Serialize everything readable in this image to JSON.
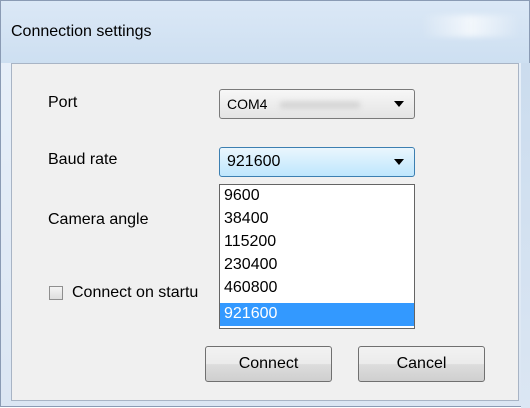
{
  "window": {
    "title": "Connection settings"
  },
  "port": {
    "label": "Port",
    "value": "COM4"
  },
  "baud": {
    "label": "Baud rate",
    "value": "921600",
    "options": [
      "9600",
      "38400",
      "115200",
      "230400",
      "460800",
      "921600"
    ],
    "selected_index": 5
  },
  "camera": {
    "label": "Camera angle"
  },
  "startup": {
    "label": "Connect on startu",
    "checked": false
  },
  "buttons": {
    "connect": "Connect",
    "cancel": "Cancel"
  },
  "colors": {
    "selection": "#3399ff",
    "title_bg": "#dbe8f6",
    "client_bg": "#f0f0f0"
  },
  "icons": {
    "dropdown_arrow": "chevron-down-icon"
  }
}
